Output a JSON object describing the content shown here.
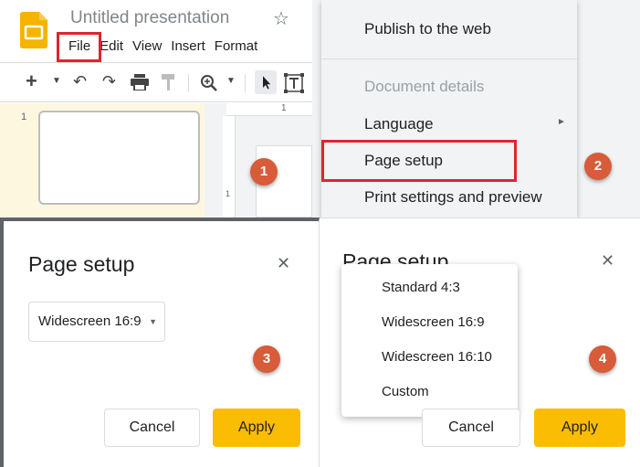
{
  "editor": {
    "doc_title": "Untitled presentation",
    "menu": [
      "File",
      "Edit",
      "View",
      "Insert",
      "Format"
    ],
    "slide_number": "1",
    "ruler_mark": "1",
    "ruler_left_mark": "1"
  },
  "file_menu": {
    "items": [
      {
        "label": "Publish to the web"
      },
      {
        "label": "Document details"
      },
      {
        "label": "Language"
      },
      {
        "label": "Page setup"
      },
      {
        "label": "Print settings and preview"
      }
    ]
  },
  "dialog": {
    "title": "Page setup",
    "selected_size": "Widescreen 16:9",
    "cancel_label": "Cancel",
    "apply_label": "Apply"
  },
  "dropdown": {
    "options": [
      "Standard 4:3",
      "Widescreen 16:9",
      "Widescreen 16:10",
      "Custom"
    ]
  },
  "steps": [
    "1",
    "2",
    "3",
    "4"
  ],
  "colors": {
    "highlight": "#e0242f",
    "step_badge": "#d85c3a",
    "apply_button": "#fbbc04"
  }
}
